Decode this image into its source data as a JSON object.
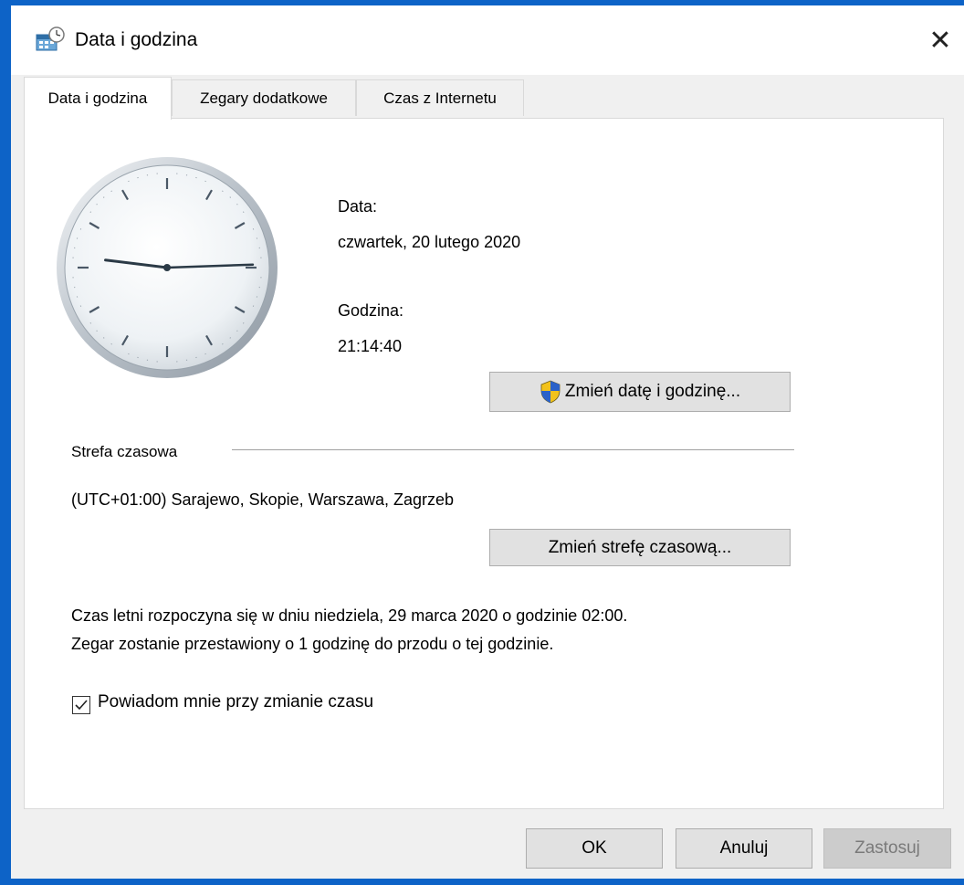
{
  "window": {
    "title": "Data i godzina",
    "close_glyph": "✕",
    "title_icon": "datetime-icon"
  },
  "tabs": [
    {
      "label": "Data i godzina",
      "active": true
    },
    {
      "label": "Zegary dodatkowe",
      "active": false
    },
    {
      "label": "Czas z Internetu",
      "active": false
    }
  ],
  "clock": {
    "hours": 21,
    "minutes": 14,
    "seconds": 40
  },
  "date_section": {
    "date_label": "Data:",
    "date_value": "czwartek, 20 lutego 2020",
    "time_label": "Godzina:",
    "time_value": "21:14:40",
    "change_button": "Zmień datę i godzinę...",
    "change_button_icon": "uac-shield-icon"
  },
  "timezone": {
    "heading": "Strefa czasowa",
    "value": "(UTC+01:00) Sarajewo, Skopie, Warszawa, Zagrzeb",
    "change_button": "Zmień strefę czasową..."
  },
  "dst": {
    "line1": "Czas letni rozpoczyna się w dniu niedziela, 29 marca 2020 o godzinie 02:00.",
    "line2": "Zegar zostanie przestawiony o 1 godzinę do przodu o tej godzinie."
  },
  "notify": {
    "label": "Powiadom mnie przy zmianie czasu",
    "checked": true
  },
  "footer": {
    "ok": "OK",
    "cancel": "Anuluj",
    "apply": "Zastosuj",
    "apply_enabled": false
  },
  "colors": {
    "desktop": "#0d63c7",
    "dialog_bg": "#f0f0f0",
    "button_bg": "#e1e1e1",
    "button_border": "#adadad"
  }
}
